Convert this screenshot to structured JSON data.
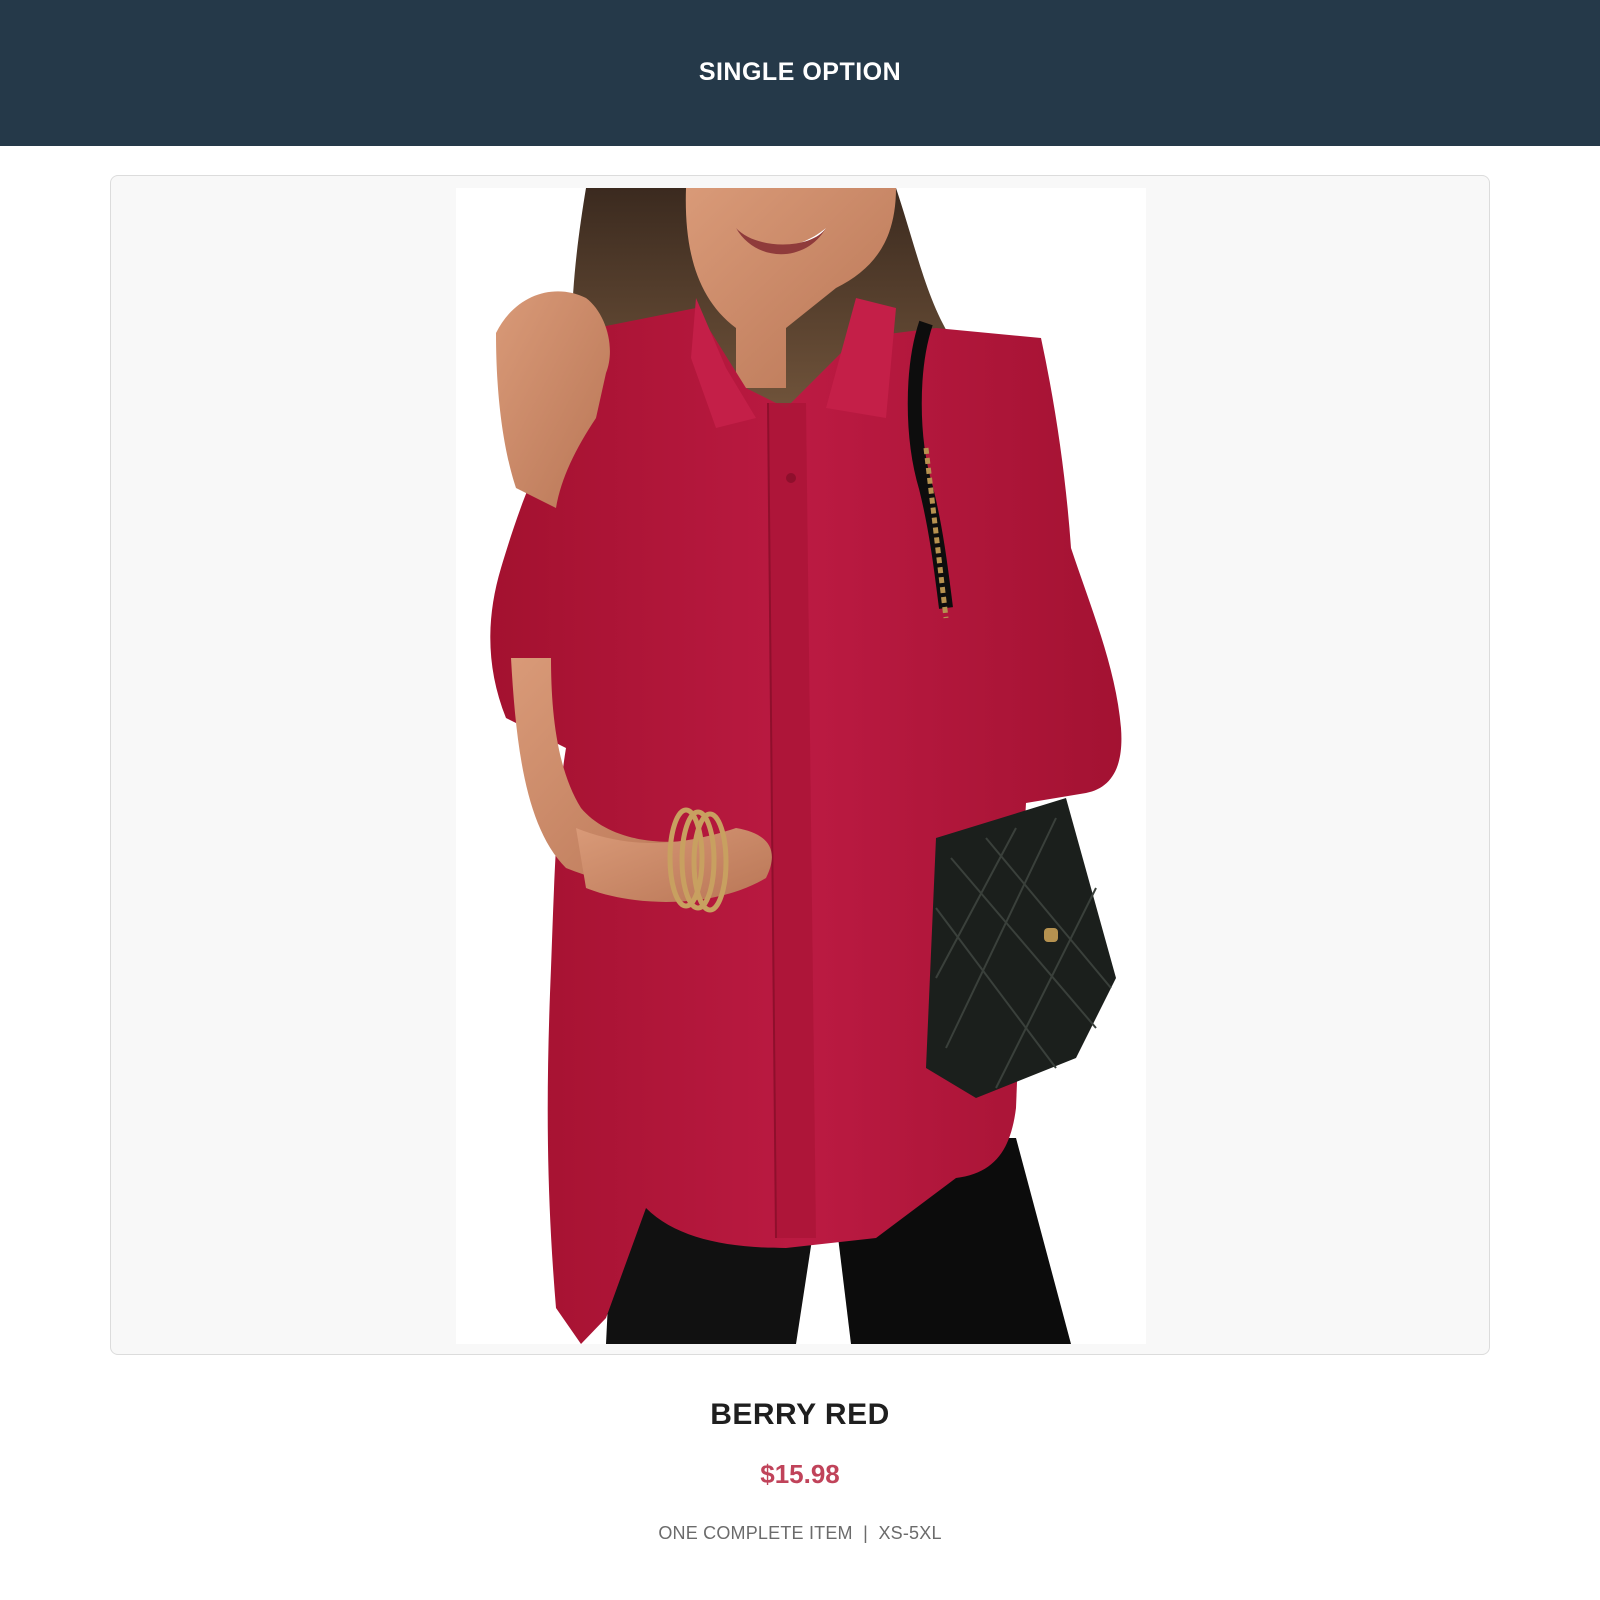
{
  "header": {
    "title": "SINGLE OPTION"
  },
  "product": {
    "image_alt": "Woman wearing berry red short-sleeve button-up shirt with black quilted shoulder bag",
    "name": "BERRY RED",
    "price": "$15.98",
    "meta_type": "ONE COMPLETE ITEM",
    "meta_separator": "|",
    "meta_sizes": "XS-5XL"
  },
  "colors": {
    "header_bg": "#253949",
    "price": "#c0435a",
    "shirt": "#b5173d"
  }
}
